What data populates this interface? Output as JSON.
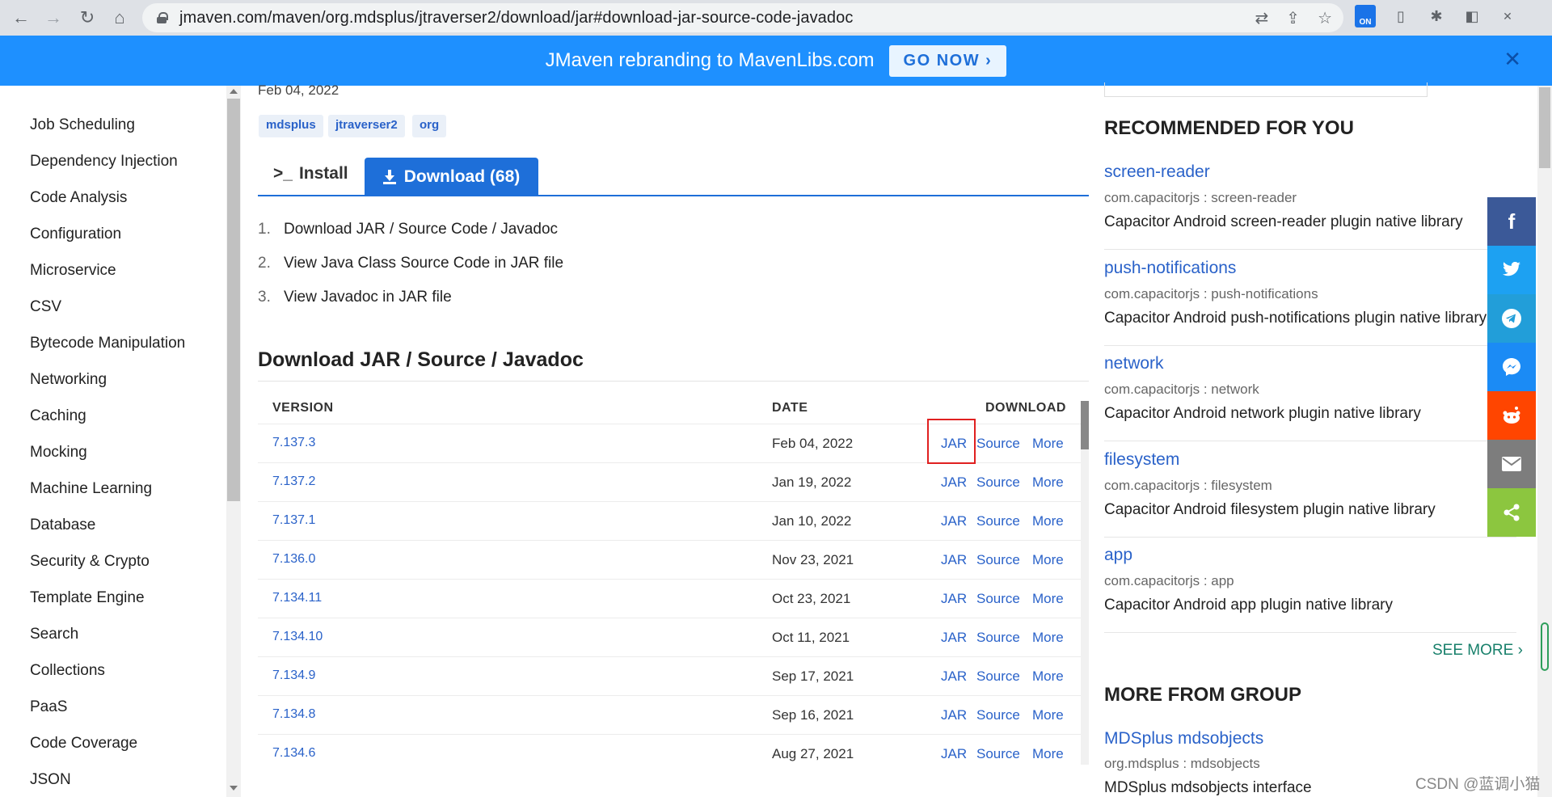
{
  "browser": {
    "url": "jmaven.com/maven/org.mdsplus/jtraverser2/download/jar#download-jar-source-code-javadoc",
    "ext_on_label": "ON"
  },
  "banner": {
    "text": "JMaven rebranding to MavenLibs.com",
    "button": "GO NOW ›"
  },
  "sidebar": {
    "items": [
      "Job Scheduling",
      "Dependency Injection",
      "Code Analysis",
      "Configuration",
      "Microservice",
      "CSV",
      "Bytecode Manipulation",
      "Networking",
      "Caching",
      "Mocking",
      "Machine Learning",
      "Database",
      "Security & Crypto",
      "Template Engine",
      "Search",
      "Collections",
      "PaaS",
      "Code Coverage",
      "JSON"
    ]
  },
  "main": {
    "date": "Feb 04, 2022",
    "tags": [
      "mdsplus",
      "jtraverser2",
      "org"
    ],
    "tab_install": "Install",
    "tab_download": "Download (68)",
    "list": [
      {
        "num": "1.",
        "text": "Download JAR / Source Code / Javadoc"
      },
      {
        "num": "2.",
        "text": "View Java Class Source Code in JAR file"
      },
      {
        "num": "3.",
        "text": "View Javadoc in JAR file"
      }
    ],
    "section_title": "Download JAR / Source / Javadoc",
    "table": {
      "headers": {
        "version": "VERSION",
        "date": "DATE",
        "download": "DOWNLOAD"
      },
      "link_jar": "JAR",
      "link_source": "Source",
      "link_more": "More",
      "rows": [
        {
          "version": "7.137.3",
          "date": "Feb 04, 2022"
        },
        {
          "version": "7.137.2",
          "date": "Jan 19, 2022"
        },
        {
          "version": "7.137.1",
          "date": "Jan 10, 2022"
        },
        {
          "version": "7.136.0",
          "date": "Nov 23, 2021"
        },
        {
          "version": "7.134.11",
          "date": "Oct 23, 2021"
        },
        {
          "version": "7.134.10",
          "date": "Oct 11, 2021"
        },
        {
          "version": "7.134.9",
          "date": "Sep 17, 2021"
        },
        {
          "version": "7.134.8",
          "date": "Sep 16, 2021"
        },
        {
          "version": "7.134.6",
          "date": "Aug 27, 2021"
        }
      ]
    }
  },
  "right": {
    "recommended_title": "RECOMMENDED FOR YOU",
    "recommended": [
      {
        "name": "screen-reader",
        "coord": "com.capacitorjs : screen-reader",
        "desc": "Capacitor Android screen-reader plugin native library"
      },
      {
        "name": "push-notifications",
        "coord": "com.capacitorjs : push-notifications",
        "desc": "Capacitor Android push-notifications plugin native library"
      },
      {
        "name": "network",
        "coord": "com.capacitorjs : network",
        "desc": "Capacitor Android network plugin native library"
      },
      {
        "name": "filesystem",
        "coord": "com.capacitorjs : filesystem",
        "desc": "Capacitor Android filesystem plugin native library"
      },
      {
        "name": "app",
        "coord": "com.capacitorjs : app",
        "desc": "Capacitor Android app plugin native library"
      }
    ],
    "see_more": "SEE MORE ›",
    "group_title": "MORE FROM GROUP",
    "group": [
      {
        "name": "MDSplus mdsobjects",
        "coord": "org.mdsplus : mdsobjects",
        "desc": "MDSplus mdsobjects interface"
      }
    ]
  },
  "share": {
    "colors": {
      "facebook": "#3b5998",
      "twitter": "#1da1f2",
      "telegram": "#229ed9",
      "messenger": "#1b8bf5",
      "reddit": "#ff4500",
      "email": "#7d7d7d",
      "share": "#8cc63f"
    }
  },
  "watermark": "CSDN @蓝调小猫"
}
